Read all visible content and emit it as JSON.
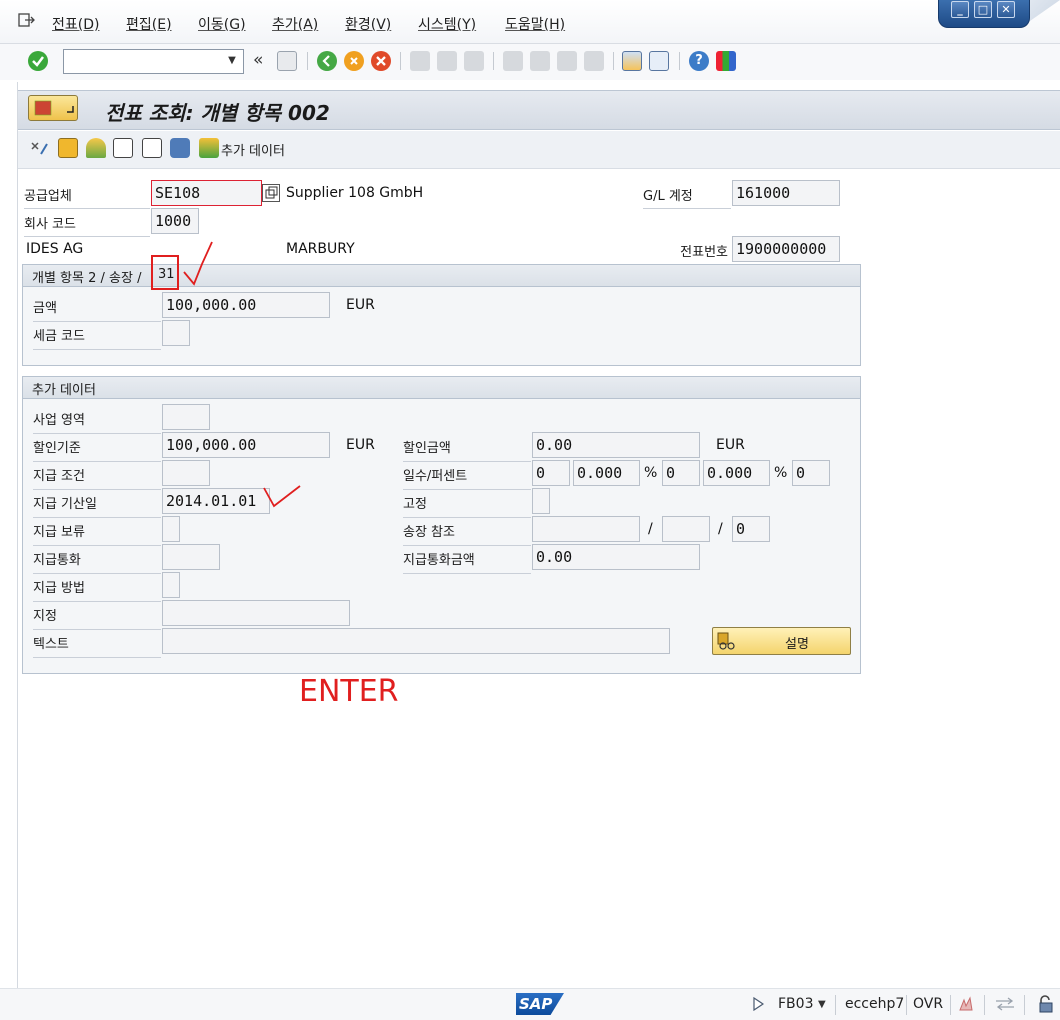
{
  "menu": {
    "items": [
      "전표(D)",
      "편집(E)",
      "이동(G)",
      "추가(A)",
      "환경(V)",
      "시스템(Y)",
      "도움말(H)"
    ]
  },
  "toolbar": {
    "command_value": "",
    "icons": [
      "enter-icon",
      "back-icon",
      "save-icon",
      "back-green-icon",
      "exit-icon",
      "cancel-icon",
      "print-icon",
      "find-icon",
      "find-next-icon",
      "first-page-icon",
      "prev-page-icon",
      "next-page-icon",
      "last-page-icon",
      "create-session-icon",
      "shortcut-icon",
      "help-icon",
      "layout-icon"
    ]
  },
  "page": {
    "title": "전표 조회: 개별 항목 002"
  },
  "app_toolbar": {
    "additional_data_label": "추가 데이터"
  },
  "header": {
    "vendor_label": "공급업체",
    "vendor_value": "SE108",
    "vendor_name": "Supplier 108 GmbH",
    "gl_label": "G/L 계정",
    "gl_value": "161000",
    "company_label": "회사 코드",
    "company_value": "1000",
    "company_name": "IDES AG",
    "city": "MARBURY",
    "docno_label": "전표번호",
    "docno_value": "1900000000"
  },
  "item_group": {
    "title_prefix": "개별 항목 2 / 송장 /",
    "posting_key": "31",
    "amount_label": "금액",
    "amount_value": "100,000.00",
    "amount_currency": "EUR",
    "tax_label": "세금 코드",
    "tax_value": ""
  },
  "additional_group": {
    "title": "추가 데이터",
    "business_area_label": "사업 영역",
    "business_area_value": "",
    "discount_base_label": "할인기준",
    "discount_base_value": "100,000.00",
    "discount_base_currency": "EUR",
    "discount_amount_label": "할인금액",
    "discount_amount_value": "0.00",
    "discount_amount_currency": "EUR",
    "terms_label": "지급 조건",
    "terms_value": "",
    "days_percent_label": "일수/퍼센트",
    "days1": "0",
    "pct1": "0.000",
    "pct_sign1": "%",
    "days2": "0",
    "pct2": "0.000",
    "pct_sign2": "%",
    "days3": "0",
    "baseline_label": "지급 기산일",
    "baseline_value": "2014.01.01",
    "fixed_label": "고정",
    "fixed_value": "",
    "block_label": "지급 보류",
    "block_value": "",
    "invoice_ref_label": "송장 참조",
    "invoice_ref_value": "",
    "slash1": "/",
    "invoice_ref_year": "",
    "slash2": "/",
    "invoice_ref_item": "0",
    "pay_currency_label": "지급통화",
    "pay_currency_value": "",
    "pay_currency_amount_label": "지급통화금액",
    "pay_currency_amount_value": "0.00",
    "pay_method_label": "지급 방법",
    "pay_method_value": "",
    "assignment_label": "지정",
    "assignment_value": "",
    "text_label": "텍스트",
    "text_value": "",
    "description_button": "설명"
  },
  "annotation": {
    "enter_text": "ENTER",
    "color": "#e01f1f"
  },
  "status_bar": {
    "logo": "SAP",
    "transaction": "FB03",
    "server": "eccehp7",
    "mode": "OVR"
  },
  "colors": {
    "frame_border": "#b7c2cf",
    "field_bg": "#f3f4f6",
    "title_bg": "#dbe1e8",
    "highlight_red": "#e01f1f"
  }
}
